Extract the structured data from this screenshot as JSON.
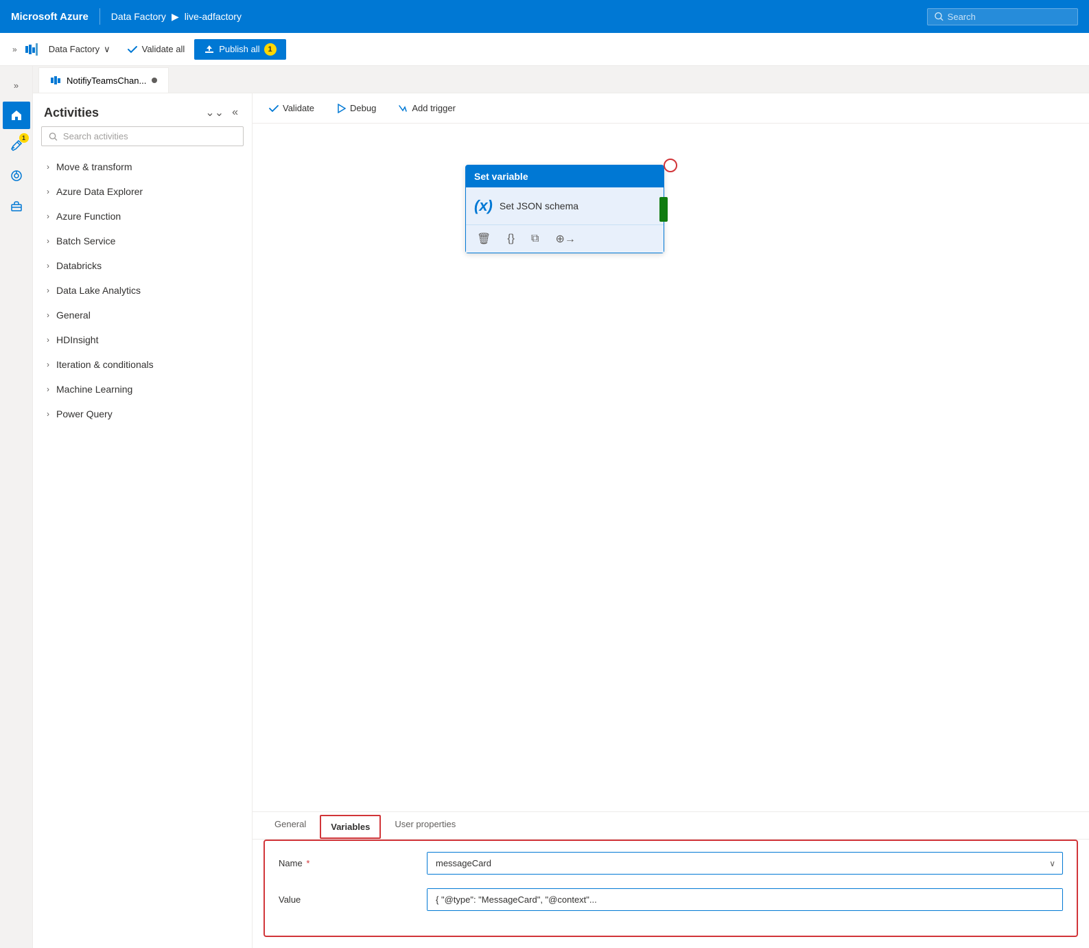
{
  "topnav": {
    "brand": "Microsoft Azure",
    "breadcrumb_service": "Data Factory",
    "breadcrumb_arrow": "▶",
    "breadcrumb_instance": "live-adfactory",
    "search_placeholder": "Search"
  },
  "second_toolbar": {
    "expand_icon": "»",
    "df_label": "Data Factory",
    "dropdown_arrow": "∨",
    "validate_label": "Validate all",
    "publish_label": "Publish all",
    "publish_badge": "1"
  },
  "icon_sidebar": {
    "expand_label": "»",
    "home_icon": "home",
    "edit_icon": "edit",
    "edit_badge": "1",
    "monitor_icon": "monitor",
    "briefcase_icon": "briefcase"
  },
  "activities_panel": {
    "title": "Activities",
    "collapse_icon": "⌄⌄",
    "close_icon": "«",
    "search_placeholder": "Search activities",
    "items": [
      {
        "label": "Move & transform"
      },
      {
        "label": "Azure Data Explorer"
      },
      {
        "label": "Azure Function"
      },
      {
        "label": "Batch Service"
      },
      {
        "label": "Databricks"
      },
      {
        "label": "Data Lake Analytics"
      },
      {
        "label": "General"
      },
      {
        "label": "HDInsight"
      },
      {
        "label": "Iteration & conditionals"
      },
      {
        "label": "Machine Learning"
      },
      {
        "label": "Power Query"
      }
    ]
  },
  "pipeline_tab": {
    "name": "NotifiyTeamsChan...",
    "dot_color": "#605e5c"
  },
  "canvas_toolbar": {
    "validate_label": "Validate",
    "debug_label": "Debug",
    "add_trigger_label": "Add trigger"
  },
  "activity_card": {
    "header": "Set variable",
    "icon_text": "(x)",
    "label": "Set JSON schema",
    "footer_icons": [
      "trash",
      "braces",
      "copy",
      "arrow-right"
    ]
  },
  "bottom_tabs": {
    "general_label": "General",
    "variables_label": "Variables",
    "user_properties_label": "User properties"
  },
  "form": {
    "name_label": "Name",
    "name_required": "*",
    "name_value": "messageCard",
    "value_label": "Value",
    "value_value": "{ \"@type\": \"MessageCard\", \"@context\"..."
  }
}
